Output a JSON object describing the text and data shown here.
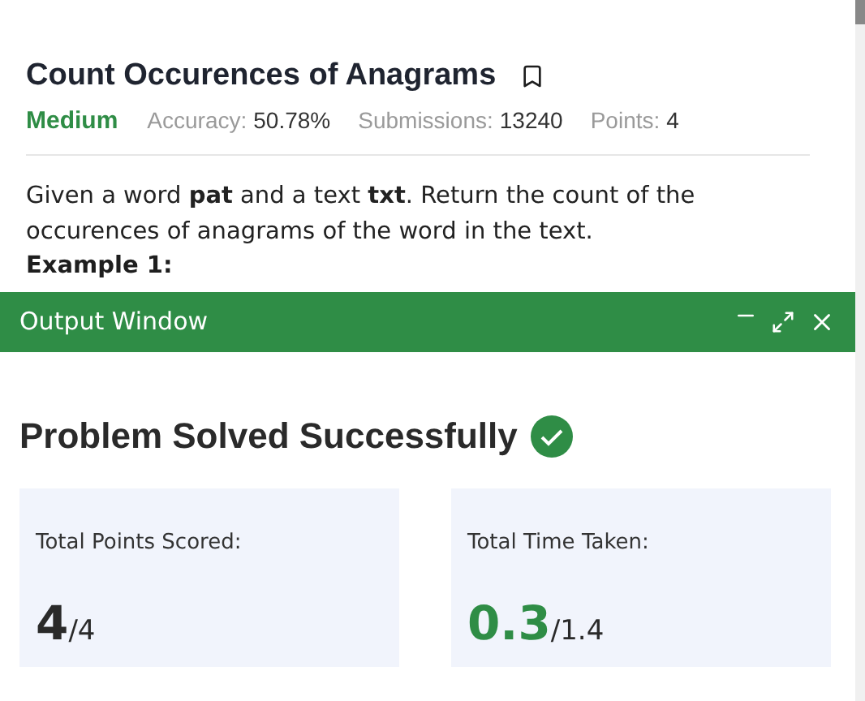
{
  "problem": {
    "title": "Count Occurences of Anagrams",
    "difficulty": "Medium",
    "stats": [
      {
        "label": "Accuracy:",
        "value": "50.78%"
      },
      {
        "label": "Submissions:",
        "value": "13240"
      },
      {
        "label": "Points:",
        "value": "4"
      }
    ],
    "description": "Given a word **pat** and a text **txt**. Return the count of the occurences of anagrams of the word in the text.",
    "example_heading": "Example 1:"
  },
  "output_window": {
    "title": "Output Window",
    "heading": "Problem Solved Successfully",
    "cards": [
      {
        "kind": "points",
        "label": "Total Points Scored:",
        "score": "4",
        "total": "/4"
      },
      {
        "kind": "time",
        "label": "Total Time Taken:",
        "score": "0.3",
        "total": "/1.4"
      }
    ]
  }
}
